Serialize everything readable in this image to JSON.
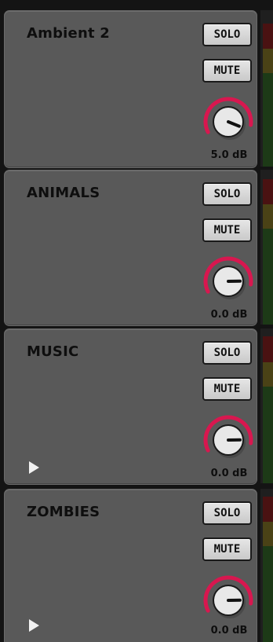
{
  "strips": [
    {
      "name": "Ambient 2",
      "solo_label": "SOLO",
      "mute_label": "MUTE",
      "gain_label": "5.0 dB",
      "gain_db": 5.0,
      "has_play": false
    },
    {
      "name": "ANIMALS",
      "solo_label": "SOLO",
      "mute_label": "MUTE",
      "gain_label": "0.0 dB",
      "gain_db": 0.0,
      "has_play": false
    },
    {
      "name": "MUSIC",
      "solo_label": "SOLO",
      "mute_label": "MUTE",
      "gain_label": "0.0 dB",
      "gain_db": 0.0,
      "has_play": true
    },
    {
      "name": "ZOMBIES",
      "solo_label": "SOLO",
      "mute_label": "MUTE",
      "gain_label": "0.0 dB",
      "gain_db": 0.0,
      "has_play": true
    }
  ],
  "colors": {
    "panel": "#595959",
    "knob_arc": "#d8174f",
    "knob_face": "#e8e8e8",
    "meter_red": "#4a1212",
    "meter_yellow": "#4a4216",
    "meter_green": "#1d3a17"
  },
  "icons": {
    "play": "play-icon",
    "knob": "gain-knob"
  }
}
